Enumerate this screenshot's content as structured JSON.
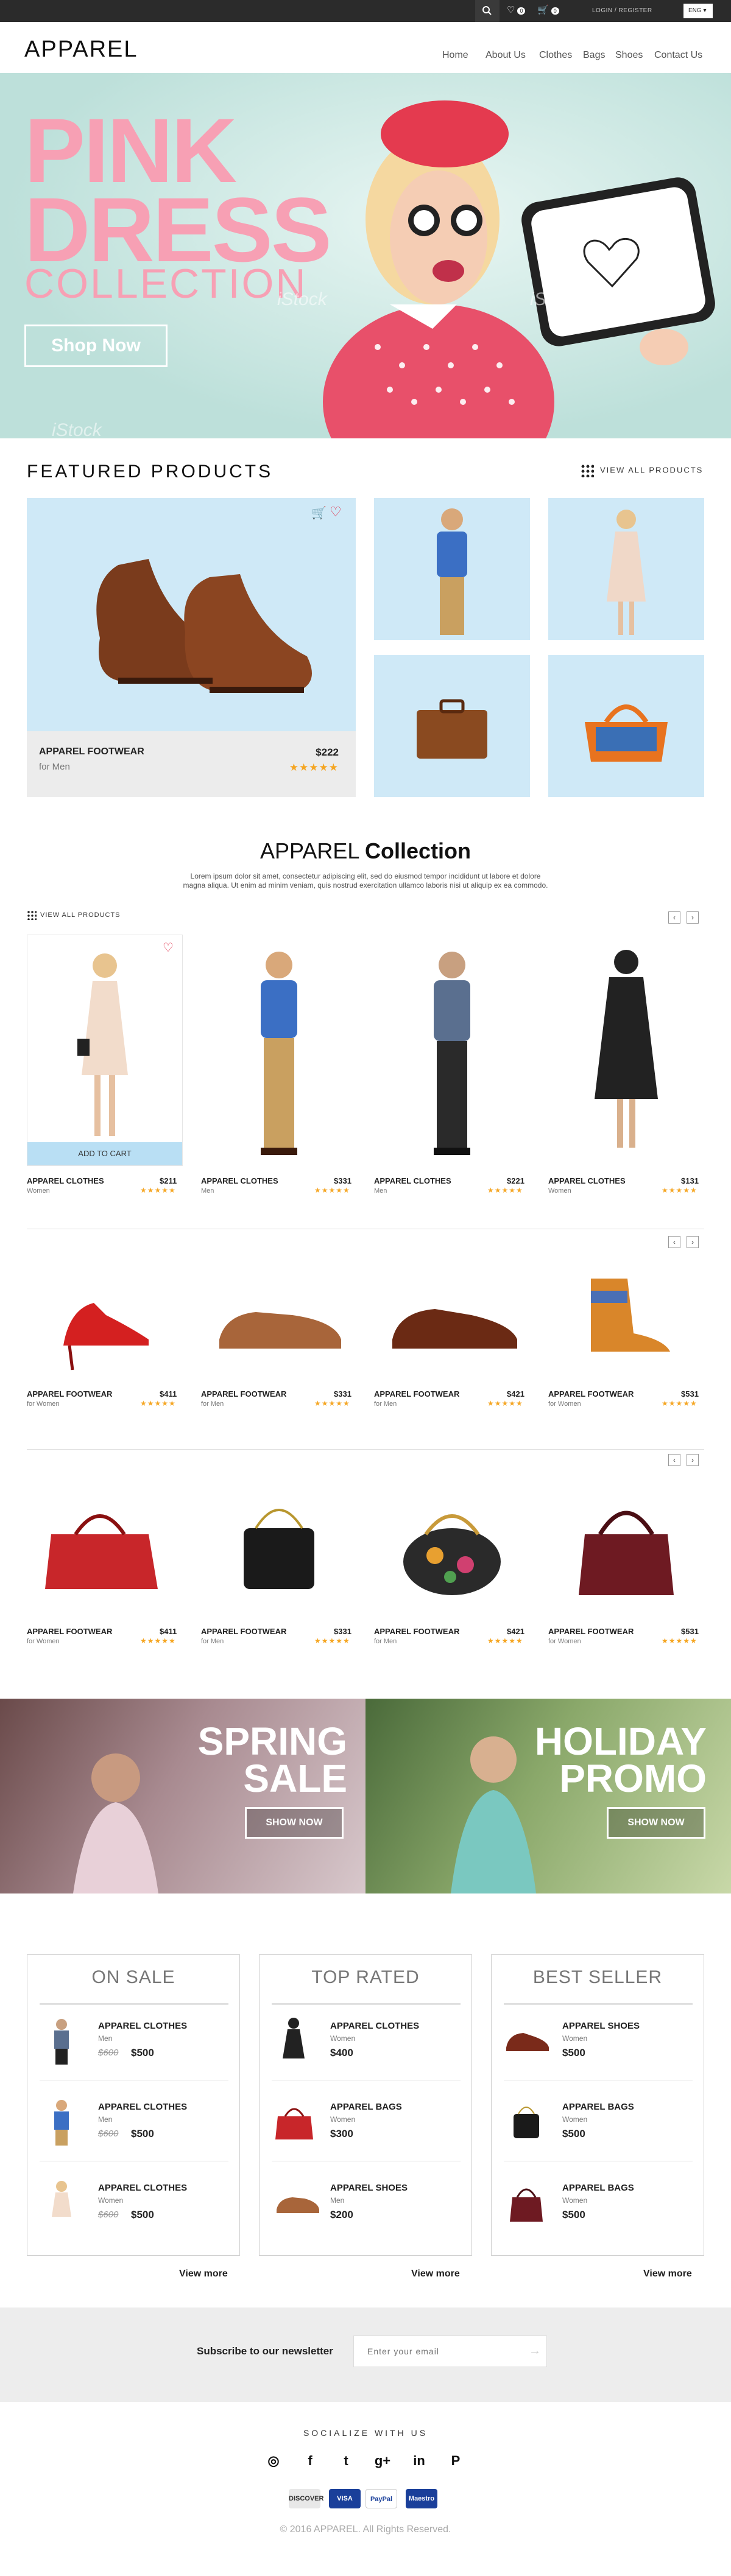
{
  "topbar": {
    "wishlist_count": "0",
    "cart_count": "0",
    "login": "LOGIN / REGISTER",
    "language": "ENG"
  },
  "header": {
    "logo": "APPAREL",
    "nav": [
      "Home",
      "About Us",
      "Clothes",
      "Bags",
      "Shoes",
      "Contact Us"
    ]
  },
  "hero": {
    "line1": "PINK",
    "line2": "DRESS",
    "line3": "COLLECTION",
    "button": "Shop Now",
    "watermark": "iStock"
  },
  "featured": {
    "title": "FEATURED PRODUCTS",
    "view_all": "VIEW ALL PRODUCTS",
    "main": {
      "name": "APPAREL FOOTWEAR",
      "sub": "for Men",
      "price": "$222",
      "rating": 5
    }
  },
  "collection": {
    "title_light": "APPAREL ",
    "title_bold": "Collection",
    "subtitle": "Lorem ipsum dolor sit amet, consectetur adipiscing elit, sed do eiusmod tempor incididunt ut labore et dolore magna aliqua. Ut enim ad minim veniam, quis nostrud exercitation ullamco laboris nisi ut aliquip ex ea commodo.",
    "view_all": "VIEW ALL PRODUCTS",
    "add_to_cart": "ADD TO CART",
    "prev": "‹",
    "next": "›",
    "row1": [
      {
        "name": "APPAREL CLOTHES",
        "sub": "Women",
        "price": "$211"
      },
      {
        "name": "APPAREL CLOTHES",
        "sub": "Men",
        "price": "$331"
      },
      {
        "name": "APPAREL CLOTHES",
        "sub": "Men",
        "price": "$221"
      },
      {
        "name": "APPAREL CLOTHES",
        "sub": "Women",
        "price": "$131"
      }
    ],
    "row2": [
      {
        "name": "APPAREL FOOTWEAR",
        "sub": "for Women",
        "price": "$411"
      },
      {
        "name": "APPAREL FOOTWEAR",
        "sub": "for Men",
        "price": "$331"
      },
      {
        "name": "APPAREL FOOTWEAR",
        "sub": "for Men",
        "price": "$421"
      },
      {
        "name": "APPAREL FOOTWEAR",
        "sub": "for Women",
        "price": "$531"
      }
    ],
    "row3": [
      {
        "name": "APPAREL FOOTWEAR",
        "sub": "for Women",
        "price": "$411"
      },
      {
        "name": "APPAREL FOOTWEAR",
        "sub": "for Men",
        "price": "$331"
      },
      {
        "name": "APPAREL FOOTWEAR",
        "sub": "for Men",
        "price": "$421"
      },
      {
        "name": "APPAREL FOOTWEAR",
        "sub": "for Women",
        "price": "$531"
      }
    ]
  },
  "promos": {
    "spring_1": "SPRING",
    "spring_2": "SALE",
    "holiday_1": "HOLIDAY",
    "holiday_2": "PROMO",
    "button": "SHOW NOW"
  },
  "lists": {
    "view_more": "View more",
    "on_sale": {
      "title": "ON SALE",
      "items": [
        {
          "name": "APPAREL CLOTHES",
          "sub": "Men",
          "old": "$600",
          "price": "$500"
        },
        {
          "name": "APPAREL CLOTHES",
          "sub": "Men",
          "old": "$600",
          "price": "$500"
        },
        {
          "name": "APPAREL CLOTHES",
          "sub": "Women",
          "old": "$600",
          "price": "$500"
        }
      ]
    },
    "top_rated": {
      "title": "TOP RATED",
      "items": [
        {
          "name": "APPAREL CLOTHES",
          "sub": "Women",
          "price": "$400"
        },
        {
          "name": "APPAREL BAGS",
          "sub": "Women",
          "price": "$300"
        },
        {
          "name": "APPAREL SHOES",
          "sub": "Men",
          "price": "$200"
        }
      ]
    },
    "best_seller": {
      "title": "BEST SELLER",
      "items": [
        {
          "name": "APPAREL SHOES",
          "sub": "Women",
          "price": "$500"
        },
        {
          "name": "APPAREL BAGS",
          "sub": "Women",
          "price": "$500"
        },
        {
          "name": "APPAREL BAGS",
          "sub": "Women",
          "price": "$500"
        }
      ]
    }
  },
  "newsletter": {
    "label": "Subscribe to our newsletter",
    "placeholder": "Enter your email"
  },
  "footer": {
    "social_title": "SOCIALIZE WITH US",
    "social": [
      "instagram",
      "facebook",
      "twitter",
      "google-plus",
      "linkedin",
      "pinterest"
    ],
    "payments": [
      "DISCOVER",
      "VISA",
      "PayPal",
      "Maestro"
    ],
    "copyright": "© 2016 APPAREL. All Rights Reserved."
  },
  "colors": {
    "accent_pink": "#f7a0b4",
    "product_bg": "#cfe9f7",
    "star": "#f5a623",
    "cart_button": "#b9dff4"
  }
}
